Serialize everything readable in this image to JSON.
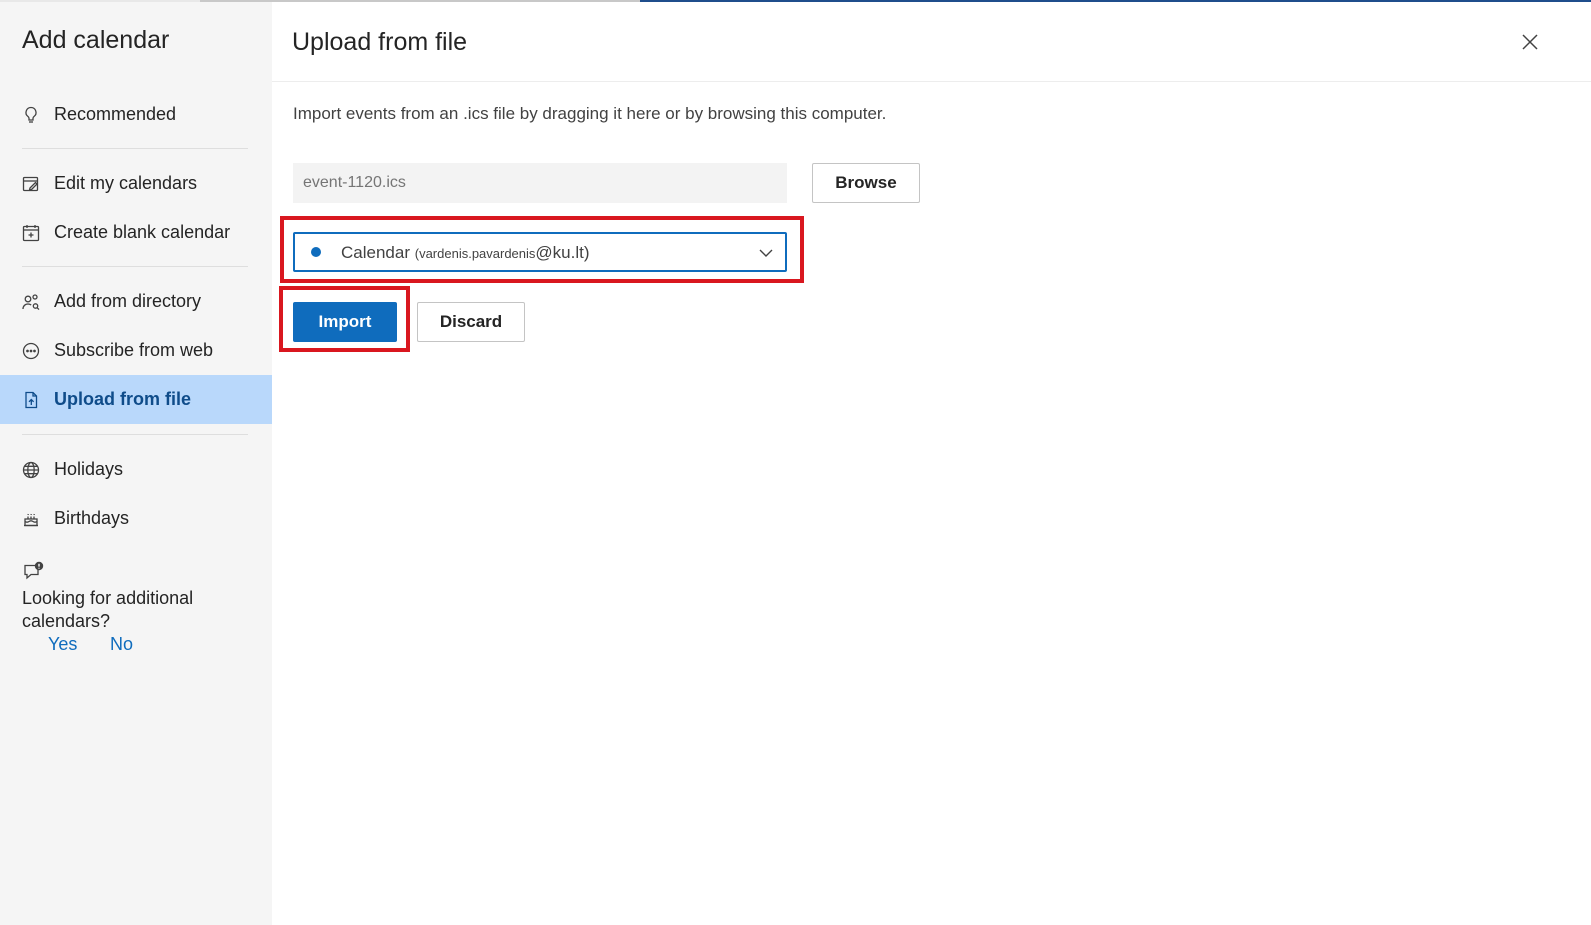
{
  "sidebar": {
    "title": "Add calendar",
    "items": [
      {
        "label": "Recommended",
        "icon": "lightbulb-icon"
      },
      {
        "label": "Edit my calendars",
        "icon": "edit-calendar-icon"
      },
      {
        "label": "Create blank calendar",
        "icon": "calendar-add-icon"
      },
      {
        "label": "Add from directory",
        "icon": "people-search-icon"
      },
      {
        "label": "Subscribe from web",
        "icon": "web-link-icon"
      },
      {
        "label": "Upload from file",
        "icon": "file-upload-icon",
        "active": true
      },
      {
        "label": "Holidays",
        "icon": "globe-icon"
      },
      {
        "label": "Birthdays",
        "icon": "cake-icon"
      }
    ],
    "feedback": {
      "question": "Looking for additional calendars?",
      "yes": "Yes",
      "no": "No"
    }
  },
  "main": {
    "title": "Upload from file",
    "description": "Import events from an .ics file by dragging it here or by browsing this computer.",
    "file_input": {
      "placeholder": "event-1120.ics"
    },
    "browse_label": "Browse",
    "calendar_select": {
      "name": "Calendar",
      "account_user": "(vardenis.pavardenis",
      "account_domain": "@ku.lt)",
      "dot_color": "#0f6cbd"
    },
    "import_label": "Import",
    "discard_label": "Discard"
  },
  "colors": {
    "accent": "#0f6cbd",
    "active_item_bg": "#b9d8fb",
    "highlight_border": "#d9171f"
  }
}
